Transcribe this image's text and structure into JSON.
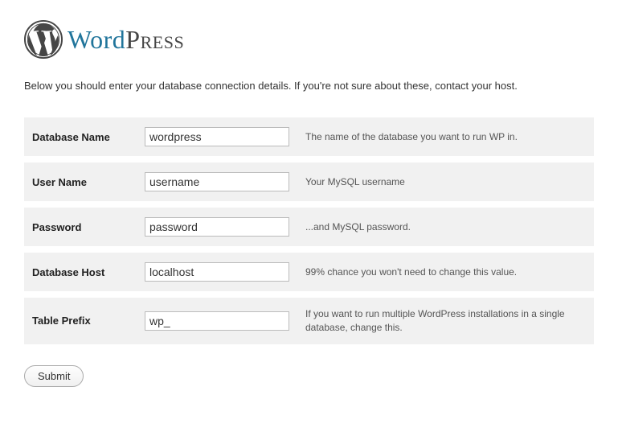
{
  "logo": {
    "word": "Word",
    "press": "Press"
  },
  "intro": "Below you should enter your database connection details. If you're not sure about these, contact your host.",
  "fields": [
    {
      "label": "Database Name",
      "value": "wordpress",
      "desc": "The name of the database you want to run WP in."
    },
    {
      "label": "User Name",
      "value": "username",
      "desc": "Your MySQL username"
    },
    {
      "label": "Password",
      "value": "password",
      "desc": "...and MySQL password."
    },
    {
      "label": "Database Host",
      "value": "localhost",
      "desc": "99% chance you won't need to change this value."
    },
    {
      "label": "Table Prefix",
      "value": "wp_",
      "desc": "If you want to run multiple WordPress installations in a single database, change this."
    }
  ],
  "submit": "Submit"
}
